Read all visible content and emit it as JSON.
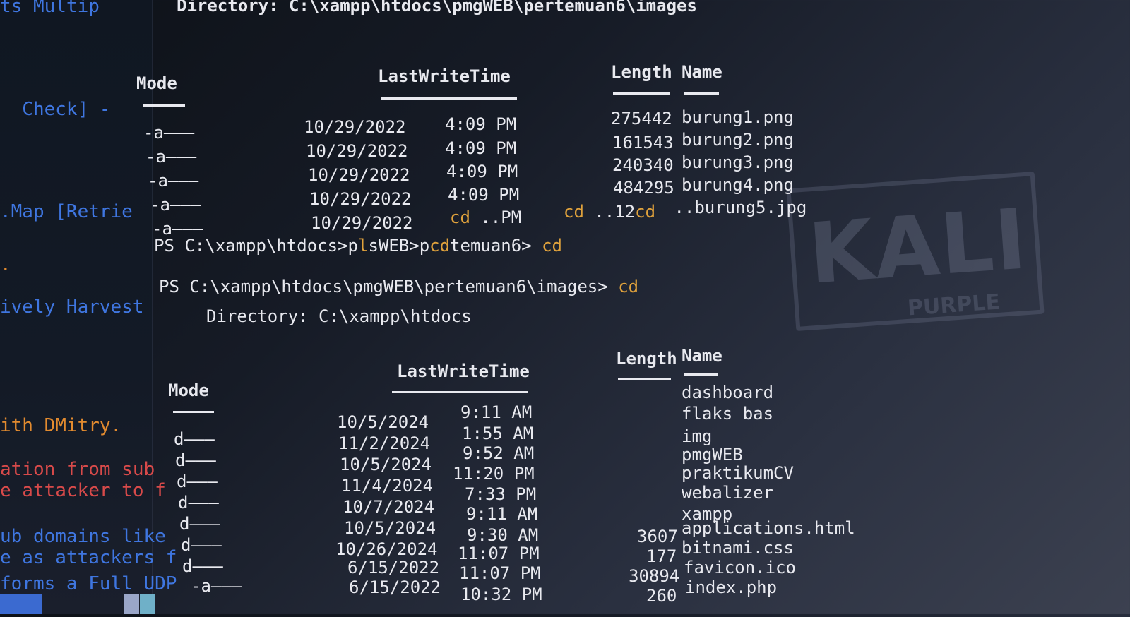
{
  "background_pane": {
    "lines": [
      {
        "text": "ts Multip",
        "color": "blue"
      },
      {
        "text": "  Check] -",
        "color": "blue"
      },
      {
        "text": ".Map [Retrie",
        "color": "blue"
      },
      {
        "text": ".",
        "color": "orange"
      },
      {
        "text": "ively Harvest",
        "color": "blue"
      },
      {
        "text": "ith DMitry.",
        "color": "orange"
      },
      {
        "text": "ation from sub",
        "color": "red"
      },
      {
        "text": "e attacker to f",
        "color": "red"
      },
      {
        "text": "ub domains like",
        "color": "blue"
      },
      {
        "text": "e as attackers f",
        "color": "blue"
      },
      {
        "text": "forms a Full UDP",
        "color": "blue"
      }
    ]
  },
  "terminal": {
    "top_directory": "Directory: C:\\xampp\\htdocs\\pmgWEB\\pertemuan6\\images",
    "table1": {
      "headers": {
        "mode": "Mode",
        "lastwritetime": "LastWriteTime",
        "length": "Length",
        "name": "Name"
      },
      "rows": [
        {
          "mode": "-a———",
          "date": "10/29/2022",
          "time": "4:09 PM",
          "length": "275442",
          "name": "burung1.png"
        },
        {
          "mode": "-a———",
          "date": "10/29/2022",
          "time": "4:09 PM",
          "length": "161543",
          "name": "burung2.png"
        },
        {
          "mode": "-a———",
          "date": "10/29/2022",
          "time": "4:09 PM",
          "length": "240340",
          "name": "burung3.png"
        },
        {
          "mode": "-a———",
          "date": "10/29/2022",
          "time": "4:09 PM",
          "length": "484295",
          "name": "burung4.png"
        },
        {
          "mode": "-a———",
          "date": "10/29/2022",
          "time_parts": [
            "cd",
            " ..PM"
          ],
          "length_parts": [
            "cd",
            " ..12",
            "cd"
          ],
          "name": " ..burung5.jpg"
        }
      ]
    },
    "prompt1": {
      "prefix": "PS C:\\xampp\\htdocs>p",
      "mid1": "l",
      "mid2": "s",
      "mid3": "WEB>p",
      "mid4": "cd",
      "mid5": "temuan6> ",
      "cmd": "cd"
    },
    "prompt2": {
      "text": "PS C:\\xampp\\htdocs\\pmgWEB\\pertemuan6\\images> ",
      "cmd": "cd"
    },
    "second_directory": "Directory: C:\\xampp\\htdocs",
    "table2": {
      "headers": {
        "mode": "Mode",
        "lastwritetime": "LastWriteTime",
        "length": "Length",
        "name": "Name"
      },
      "rows": [
        {
          "mode": "",
          "date": "",
          "time": "",
          "length": "",
          "name": "dashboard"
        },
        {
          "mode": "",
          "date": "",
          "time": "",
          "length": "",
          "name": "flaks bas"
        },
        {
          "mode": "d———",
          "date": "10/5/2024",
          "time": "9:11 AM",
          "length": "",
          "name": "img"
        },
        {
          "mode": "d———",
          "date": "11/2/2024",
          "time": "1:55 AM",
          "length": "",
          "name": "pmgWEB"
        },
        {
          "mode": "d———",
          "date": "10/5/2024",
          "time": "9:52 AM",
          "length": "",
          "name": "praktikumCV"
        },
        {
          "mode": "d———",
          "date": "11/4/2024",
          "time": "11:20 PM",
          "length": "",
          "name": "webalizer"
        },
        {
          "mode": "d———",
          "date": "10/7/2024",
          "time": "7:33 PM",
          "length": "",
          "name": "xampp"
        },
        {
          "mode": "d———",
          "date": "10/5/2024",
          "time": "9:11 AM",
          "length": "3607",
          "name": "applications.html"
        },
        {
          "mode": "d———",
          "date": "10/26/2024",
          "time": "9:30 AM",
          "length": "177",
          "name": "bitnami.css"
        },
        {
          "mode": "",
          "date": "6/15/2022",
          "time": "11:07 PM",
          "length": "30894",
          "name": "favicon.ico"
        },
        {
          "mode": "-a———",
          "date": "6/15/2022",
          "time": "11:07 PM",
          "length": "260",
          "name": "index.php"
        },
        {
          "mode": "",
          "date": "",
          "time": "10:32 PM",
          "length": "",
          "name": ""
        }
      ]
    }
  },
  "watermark": {
    "title": "KALI",
    "subtitle": "PURPLE"
  },
  "colors": {
    "text": "#e8e9ef",
    "cd_yellow": "#e0a23c",
    "blue": "#3f76e0",
    "red": "#d84a4a",
    "orange": "#e38b2f"
  }
}
